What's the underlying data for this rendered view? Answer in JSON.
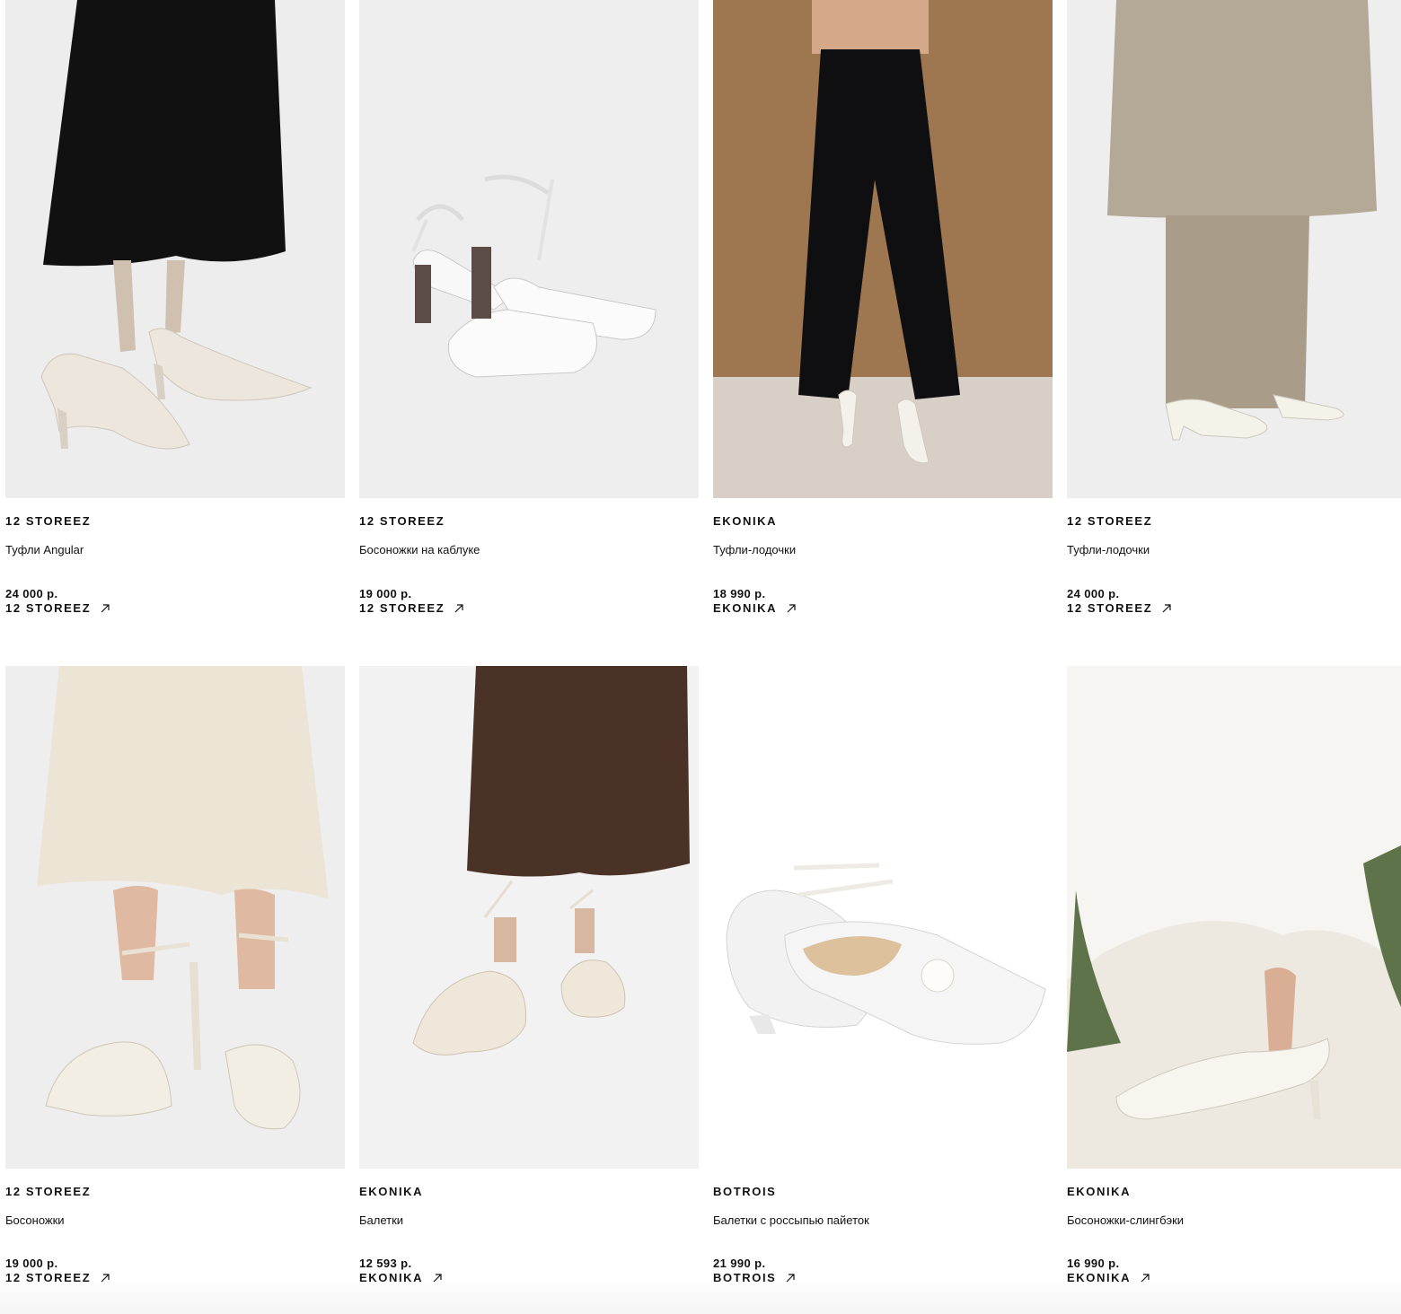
{
  "products": [
    {
      "brand": "12 STOREEZ",
      "name": "Туфли Angular",
      "price": "24 000 р.",
      "shop": "12 STOREEZ",
      "image_icon": "pumps-on-model-photo"
    },
    {
      "brand": "12 STOREEZ",
      "name": "Босоножки на каблуке",
      "price": "19 000 р.",
      "shop": "12 STOREEZ",
      "image_icon": "strappy-sandals-photo"
    },
    {
      "brand": "EKONIKA",
      "name": "Туфли-лодочки",
      "price": "18 990 р.",
      "shop": "EKONIKA",
      "image_icon": "pumps-with-trousers-photo"
    },
    {
      "brand": "12 STOREEZ",
      "name": "Туфли-лодочки",
      "price": "24 000 р.",
      "shop": "12 STOREEZ",
      "image_icon": "pumps-with-coat-photo"
    },
    {
      "brand": "12 STOREEZ",
      "name": "Босоножки",
      "price": "19 000 р.",
      "shop": "12 STOREEZ",
      "image_icon": "knot-sandals-photo"
    },
    {
      "brand": "EKONIKA",
      "name": "Балетки",
      "price": "12 593 р.",
      "shop": "EKONIKA",
      "image_icon": "lace-up-ballet-flats-photo"
    },
    {
      "brand": "BOTROIS",
      "name": "Балетки с россыпью пайеток",
      "price": "21 990 р.",
      "shop": "BOTROIS",
      "image_icon": "sequin-ballet-flats-photo"
    },
    {
      "brand": "EKONIKA",
      "name": "Босоножки-слингбэки",
      "price": "16 990 р.",
      "shop": "EKONIKA",
      "image_icon": "slingback-sandals-photo"
    }
  ],
  "colors": {
    "text": "#111111",
    "background": "#ffffff"
  }
}
